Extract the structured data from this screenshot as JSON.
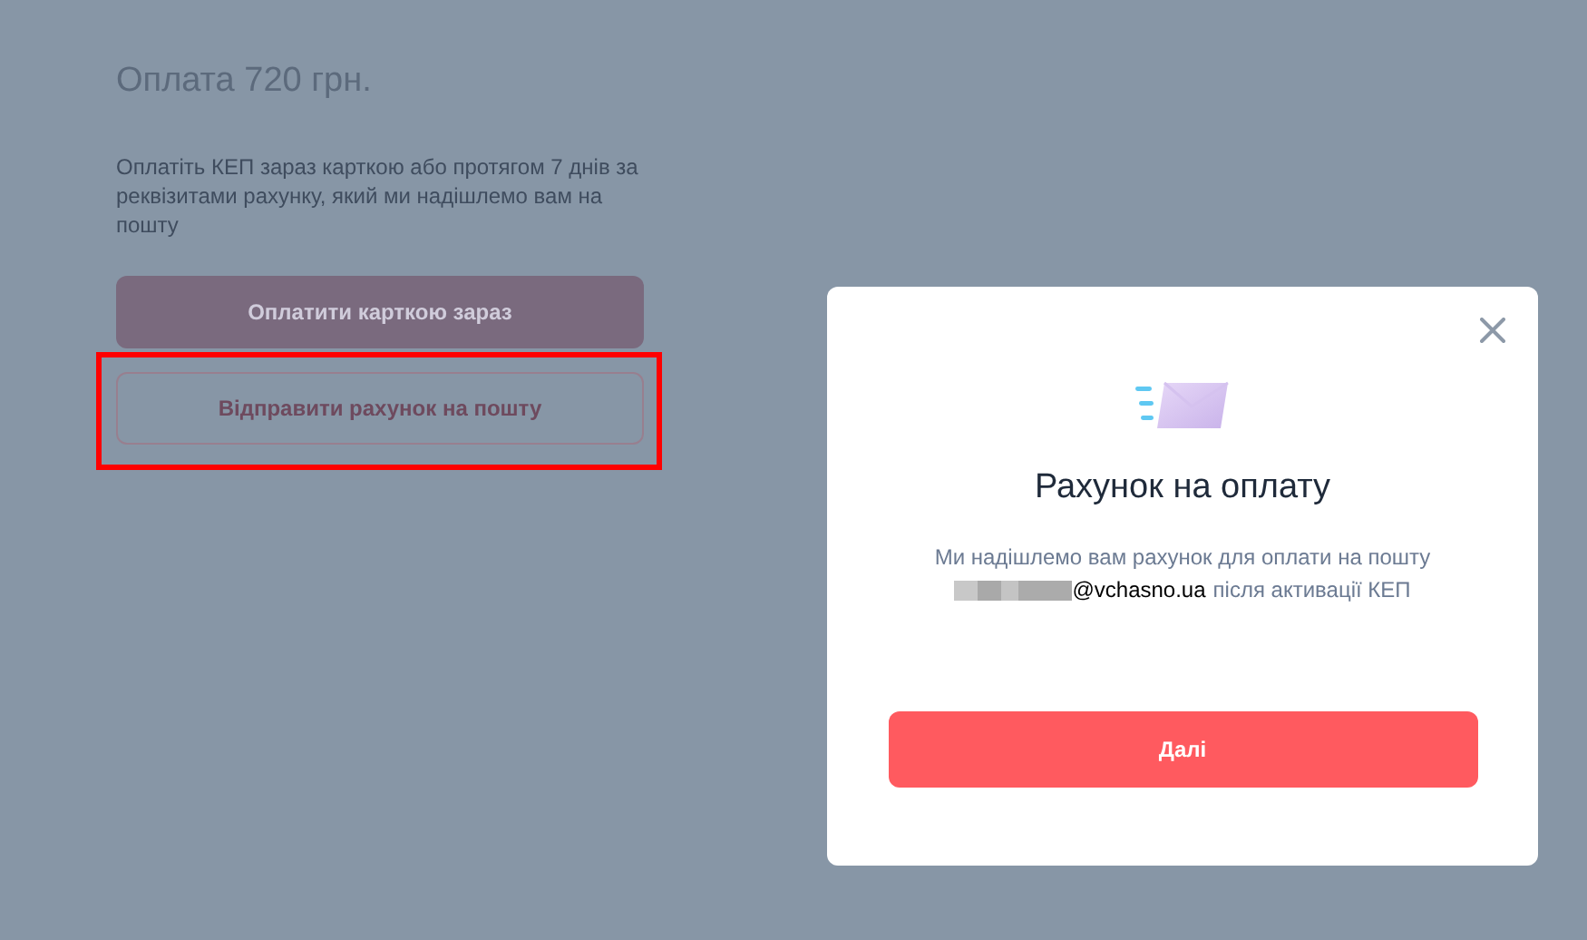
{
  "page": {
    "title": "Оплата 720 грн.",
    "description": "Оплатіть КЕП зараз карткою або протягом 7 днів за реквізитами рахунку, який ми надішлемо вам на пошту",
    "buttons": [
      {
        "label": "Оплатити карткою зараз",
        "kind": "primary",
        "highlighted": false
      },
      {
        "label": "Відправити рахунок на пошту",
        "kind": "outline",
        "highlighted": true
      }
    ]
  },
  "dialog": {
    "title": "Рахунок на оплату",
    "message": "Ми надішлемо вам рахунок для оплати на пошту",
    "email": "@vchasno.ua",
    "message_end": "після активації КЕП",
    "button": "Далі"
  }
}
